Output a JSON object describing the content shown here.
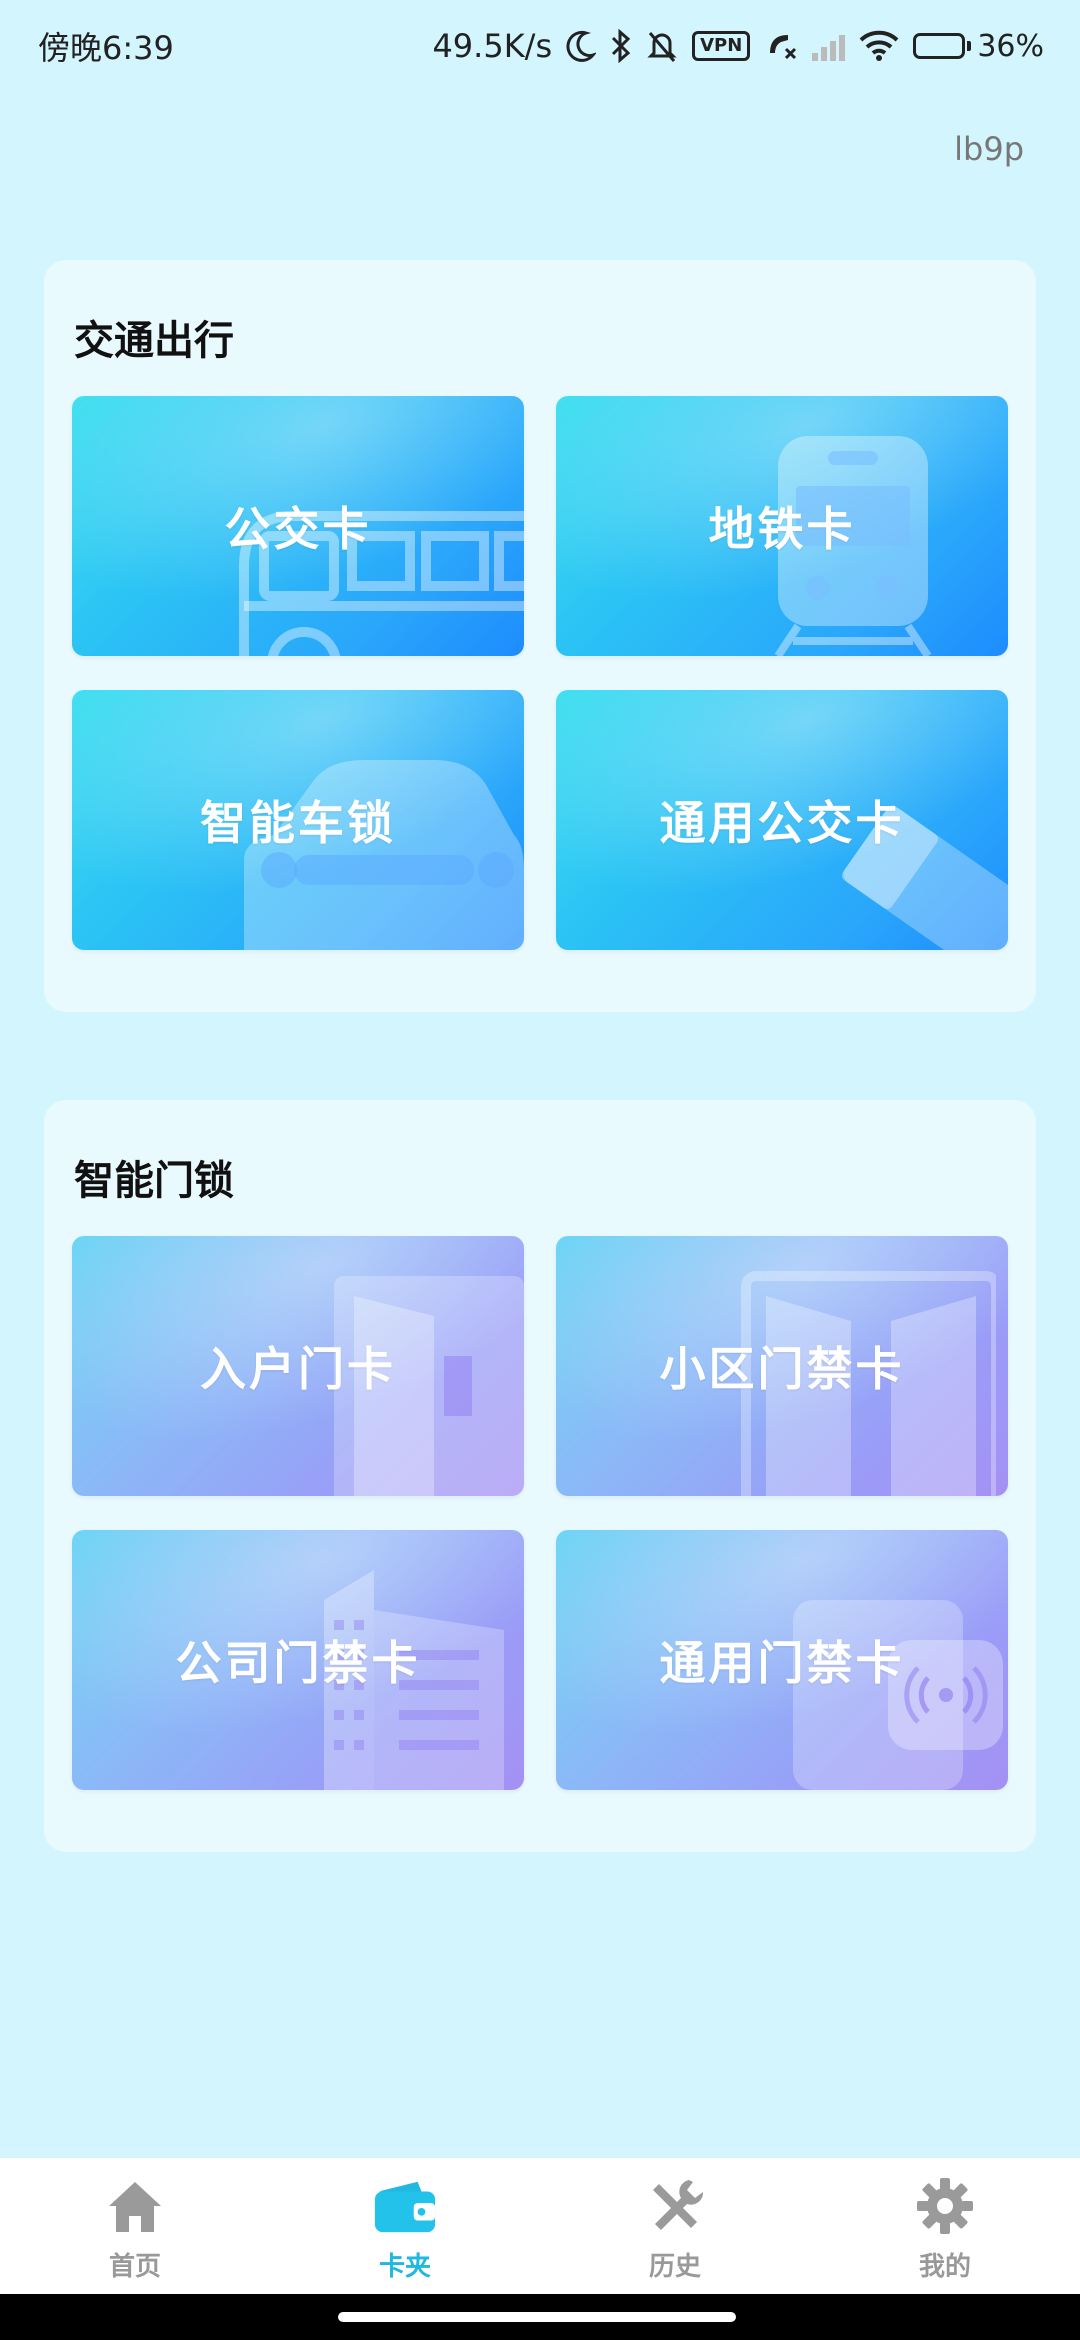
{
  "status_bar": {
    "time": "傍晚6:39",
    "network_speed": "49.5K/s",
    "vpn": "VPN",
    "battery_level": 0.36,
    "battery_text": "36%"
  },
  "account": {
    "id": "lb9p"
  },
  "sections": {
    "transport": {
      "title": "交通出行",
      "cards": [
        {
          "label": "公交卡",
          "icon": "bus-icon"
        },
        {
          "label": "地铁卡",
          "icon": "metro-train-icon"
        },
        {
          "label": "智能车锁",
          "icon": "car-icon"
        },
        {
          "label": "通用公交卡",
          "icon": "card-ticket-icon"
        }
      ]
    },
    "door": {
      "title": "智能门锁",
      "cards": [
        {
          "label": "入户门卡",
          "icon": "door-icon"
        },
        {
          "label": "小区门禁卡",
          "icon": "gate-icon"
        },
        {
          "label": "公司门禁卡",
          "icon": "building-icon"
        },
        {
          "label": "通用门禁卡",
          "icon": "nfc-card-icon"
        }
      ]
    }
  },
  "bottom_nav": {
    "items": [
      {
        "label": "首页",
        "icon": "home-icon",
        "active": false
      },
      {
        "label": "卡夹",
        "icon": "wallet-icon",
        "active": true
      },
      {
        "label": "历史",
        "icon": "tools-icon",
        "active": false
      },
      {
        "label": "我的",
        "icon": "gear-icon",
        "active": false
      }
    ]
  },
  "colors": {
    "background": "#d3f5fd",
    "section_bg": "#e8fafe",
    "active_nav": "#1fb8e0",
    "inactive_nav": "#999999"
  }
}
